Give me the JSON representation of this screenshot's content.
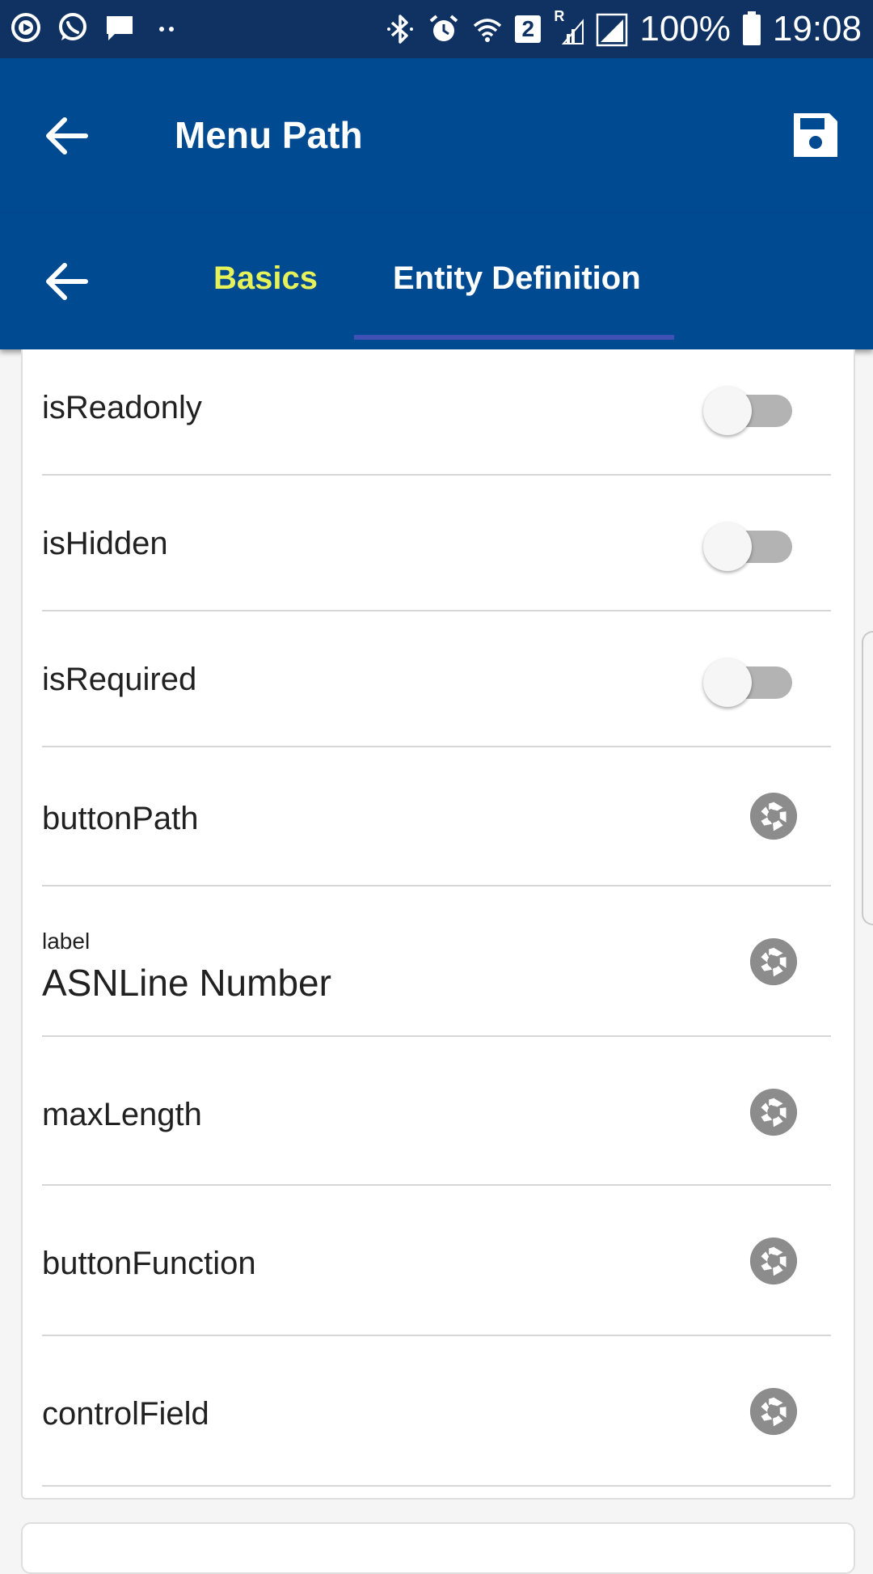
{
  "status_bar": {
    "battery_percent": "100%",
    "time": "19:08",
    "sim_badge": "2",
    "roaming_badge": "R",
    "icons": [
      "play-circle-icon",
      "whatsapp-icon",
      "message-icon",
      "more-dots-icon",
      "bluetooth-icon",
      "alarm-icon",
      "wifi-icon",
      "signal-icon",
      "battery-icon"
    ]
  },
  "app_bar": {
    "title": "Menu Path",
    "back_icon": "arrow-left-icon",
    "save_icon": "floppy-disk-icon"
  },
  "tabs": {
    "back_icon": "arrow-left-icon",
    "items": [
      {
        "label": "Basics",
        "active": false,
        "color": "#e6f25a"
      },
      {
        "label": "Entity Definition",
        "active": true,
        "color": "#ffffff"
      }
    ],
    "indicator_color": "#3f51b5"
  },
  "fields": [
    {
      "type": "toggle",
      "label": "isReadonly",
      "value": false
    },
    {
      "type": "toggle",
      "label": "isHidden",
      "value": false
    },
    {
      "type": "toggle",
      "label": "isRequired",
      "value": false
    },
    {
      "type": "action",
      "label": "buttonPath",
      "icon": "aperture-icon"
    },
    {
      "type": "value",
      "label": "label",
      "value": "ASNLine Number",
      "icon": "aperture-icon"
    },
    {
      "type": "action",
      "label": "maxLength",
      "icon": "aperture-icon"
    },
    {
      "type": "action",
      "label": "buttonFunction",
      "icon": "aperture-icon"
    },
    {
      "type": "action",
      "label": "controlField",
      "icon": "aperture-icon"
    }
  ],
  "colors": {
    "status_bar": "#0f3263",
    "primary": "#004a92",
    "toggle_track": "#b3b3b3",
    "icon_gray": "#8c8c8c"
  }
}
